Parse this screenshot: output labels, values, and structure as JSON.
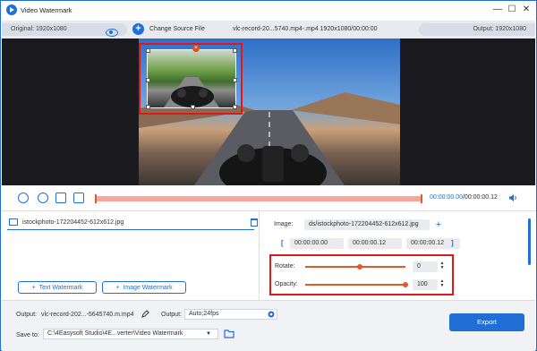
{
  "window": {
    "title": "Video Watermark",
    "minimize": "—",
    "maximize": "☐",
    "close": "✕"
  },
  "topbar": {
    "original": "Original: 1920x1080",
    "change_source": "Change Source File",
    "file_info": "vlc-record-20...5740.mp4-.mp4    1920x1080/00:00:00",
    "output_res": "Output: 1920x1080"
  },
  "timeline": {
    "current_time": "00:00:00.00",
    "total_time": "/00:00:00.12"
  },
  "watermark_list": {
    "items": [
      {
        "label": "istockphoto-172204452-612x612.jpg"
      }
    ],
    "text_button": "Text Watermark",
    "image_button": "Image Watermark"
  },
  "settings": {
    "image_label": "Image:",
    "image_value": "ds/istockphoto-172204452-612x612.jpg",
    "time_start": "00:00:00.00",
    "time_mid": "00:00:00.12",
    "time_end": "00:00:00.12",
    "rotate_label": "Rotate:",
    "rotate_value": "0",
    "opacity_label": "Opacity:",
    "opacity_value": "100",
    "opacity_level": 1.0
  },
  "bottom": {
    "output_label": "Output:",
    "output_file": "vlc-record-202...-5645740.m.mp4",
    "format_label": "Output:",
    "format_value": "Auto;24fps",
    "save_label": "Save to:",
    "save_path": "C:\\4Easysoft Studio\\4E...verter\\Video Watermark",
    "export": "Export"
  },
  "colors": {
    "accent": "#1f6fd6",
    "highlight": "#e0181b",
    "slider": "#e25a2a"
  }
}
